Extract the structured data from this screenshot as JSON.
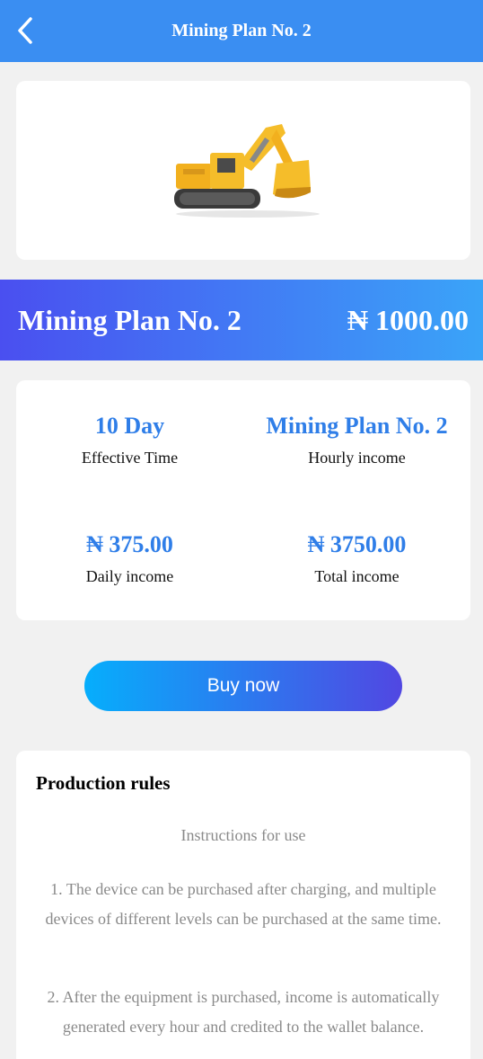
{
  "header": {
    "title": "Mining Plan No. 2"
  },
  "product": {
    "name": "Mining Plan No. 2",
    "price": "₦ 1000.00",
    "image_icon": "excavator-icon"
  },
  "stats": [
    {
      "value": "10 Day",
      "label": "Effective Time"
    },
    {
      "value": "Mining Plan No. 2",
      "label": "Hourly income"
    },
    {
      "value": "₦ 375.00",
      "label": "Daily income"
    },
    {
      "value": "₦ 3750.00",
      "label": "Total income"
    }
  ],
  "buy_button": {
    "label": "Buy now"
  },
  "rules": {
    "title": "Production rules",
    "subtitle": "Instructions for use",
    "items": [
      "1. The device can be purchased after charging, and multiple devices of different levels can be purchased at the same time.",
      "2. After the equipment is purchased, income is automatically generated every hour and credited to the wallet balance."
    ]
  },
  "colors": {
    "header": "#3a8ef2",
    "accent": "#2f7ee8",
    "banner_start": "#4a4ff0",
    "banner_end": "#3aa4f8",
    "button_start": "#06aefc",
    "button_end": "#5147e2"
  }
}
